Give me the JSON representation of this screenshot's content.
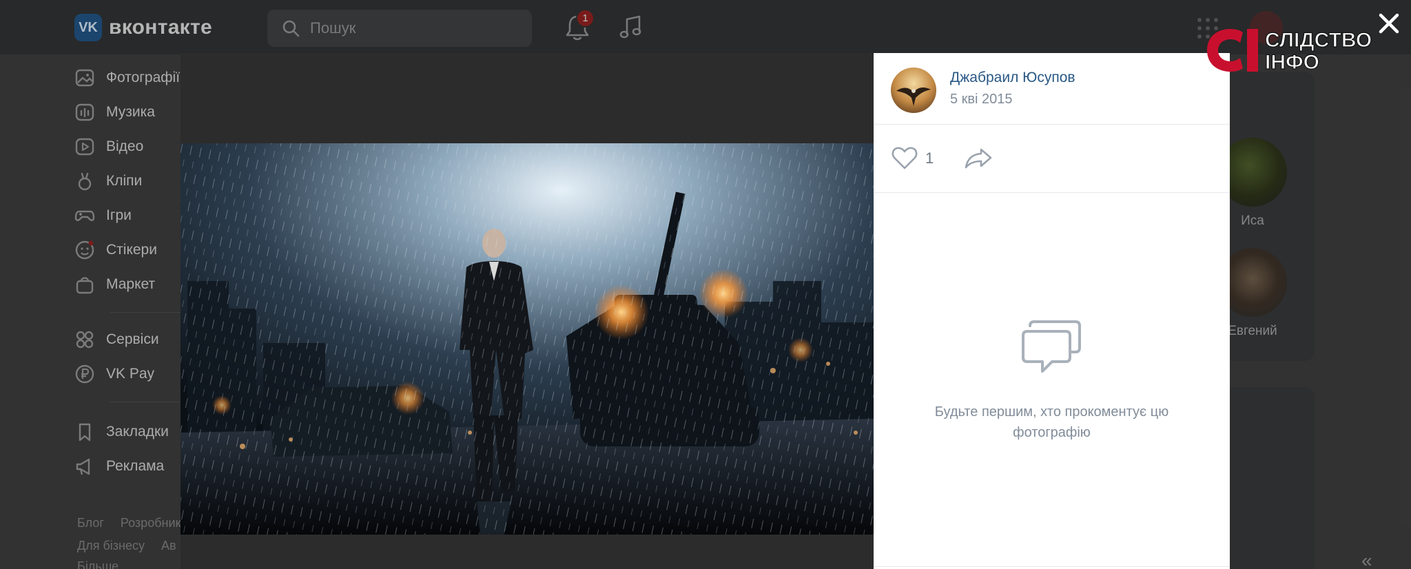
{
  "header": {
    "logo_mark": "VK",
    "logo_text": "вконтакте",
    "search_placeholder": "Пошук",
    "notifications_count": "1"
  },
  "sidebar": {
    "items": [
      {
        "label": "Фотографії",
        "icon": "photo-icon"
      },
      {
        "label": "Музика",
        "icon": "music-icon"
      },
      {
        "label": "Відео",
        "icon": "video-icon"
      },
      {
        "label": "Кліпи",
        "icon": "clips-icon"
      },
      {
        "label": "Ігри",
        "icon": "gamepad-icon"
      },
      {
        "label": "Стікери",
        "icon": "sticker-icon"
      },
      {
        "label": "Маркет",
        "icon": "market-icon"
      },
      {
        "label": "Сервіси",
        "icon": "services-icon"
      },
      {
        "label": "VK Pay",
        "icon": "vkpay-icon"
      },
      {
        "label": "Закладки",
        "icon": "bookmark-icon"
      },
      {
        "label": "Реклама",
        "icon": "ads-icon"
      }
    ],
    "footer_row1": [
      "Блог",
      "Розробникам"
    ],
    "footer_row2": [
      "Для бізнесу",
      "Ав"
    ],
    "footer_row3": [
      "Більше"
    ]
  },
  "friends": [
    {
      "name": "Иса"
    },
    {
      "name": "Евгений"
    }
  ],
  "photo_viewer": {
    "author": "Джабраил Юсупов",
    "date": "5 кві 2015",
    "likes": "1",
    "empty_comments": "Будьте першим, хто прокоментує цю фотографію"
  },
  "watermark": {
    "mark": "СІ",
    "line1": "СЛІДСТВО",
    "line2": "ІНФО"
  },
  "colors": {
    "accent_link": "#2a5885",
    "secondary_text": "#818c99",
    "watermark_red": "#c8102e"
  }
}
